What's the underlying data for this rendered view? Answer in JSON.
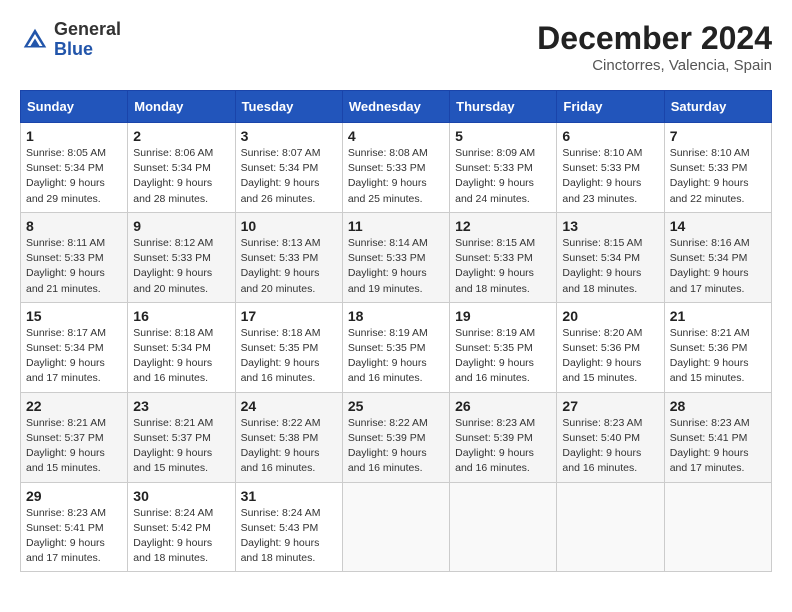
{
  "header": {
    "logo_general": "General",
    "logo_blue": "Blue",
    "month_title": "December 2024",
    "location": "Cinctorres, Valencia, Spain"
  },
  "weekdays": [
    "Sunday",
    "Monday",
    "Tuesday",
    "Wednesday",
    "Thursday",
    "Friday",
    "Saturday"
  ],
  "weeks": [
    [
      {
        "day": "1",
        "sunrise": "8:05 AM",
        "sunset": "5:34 PM",
        "daylight": "9 hours and 29 minutes."
      },
      {
        "day": "2",
        "sunrise": "8:06 AM",
        "sunset": "5:34 PM",
        "daylight": "9 hours and 28 minutes."
      },
      {
        "day": "3",
        "sunrise": "8:07 AM",
        "sunset": "5:34 PM",
        "daylight": "9 hours and 26 minutes."
      },
      {
        "day": "4",
        "sunrise": "8:08 AM",
        "sunset": "5:33 PM",
        "daylight": "9 hours and 25 minutes."
      },
      {
        "day": "5",
        "sunrise": "8:09 AM",
        "sunset": "5:33 PM",
        "daylight": "9 hours and 24 minutes."
      },
      {
        "day": "6",
        "sunrise": "8:10 AM",
        "sunset": "5:33 PM",
        "daylight": "9 hours and 23 minutes."
      },
      {
        "day": "7",
        "sunrise": "8:10 AM",
        "sunset": "5:33 PM",
        "daylight": "9 hours and 22 minutes."
      }
    ],
    [
      {
        "day": "8",
        "sunrise": "8:11 AM",
        "sunset": "5:33 PM",
        "daylight": "9 hours and 21 minutes."
      },
      {
        "day": "9",
        "sunrise": "8:12 AM",
        "sunset": "5:33 PM",
        "daylight": "9 hours and 20 minutes."
      },
      {
        "day": "10",
        "sunrise": "8:13 AM",
        "sunset": "5:33 PM",
        "daylight": "9 hours and 20 minutes."
      },
      {
        "day": "11",
        "sunrise": "8:14 AM",
        "sunset": "5:33 PM",
        "daylight": "9 hours and 19 minutes."
      },
      {
        "day": "12",
        "sunrise": "8:15 AM",
        "sunset": "5:33 PM",
        "daylight": "9 hours and 18 minutes."
      },
      {
        "day": "13",
        "sunrise": "8:15 AM",
        "sunset": "5:34 PM",
        "daylight": "9 hours and 18 minutes."
      },
      {
        "day": "14",
        "sunrise": "8:16 AM",
        "sunset": "5:34 PM",
        "daylight": "9 hours and 17 minutes."
      }
    ],
    [
      {
        "day": "15",
        "sunrise": "8:17 AM",
        "sunset": "5:34 PM",
        "daylight": "9 hours and 17 minutes."
      },
      {
        "day": "16",
        "sunrise": "8:18 AM",
        "sunset": "5:34 PM",
        "daylight": "9 hours and 16 minutes."
      },
      {
        "day": "17",
        "sunrise": "8:18 AM",
        "sunset": "5:35 PM",
        "daylight": "9 hours and 16 minutes."
      },
      {
        "day": "18",
        "sunrise": "8:19 AM",
        "sunset": "5:35 PM",
        "daylight": "9 hours and 16 minutes."
      },
      {
        "day": "19",
        "sunrise": "8:19 AM",
        "sunset": "5:35 PM",
        "daylight": "9 hours and 16 minutes."
      },
      {
        "day": "20",
        "sunrise": "8:20 AM",
        "sunset": "5:36 PM",
        "daylight": "9 hours and 15 minutes."
      },
      {
        "day": "21",
        "sunrise": "8:21 AM",
        "sunset": "5:36 PM",
        "daylight": "9 hours and 15 minutes."
      }
    ],
    [
      {
        "day": "22",
        "sunrise": "8:21 AM",
        "sunset": "5:37 PM",
        "daylight": "9 hours and 15 minutes."
      },
      {
        "day": "23",
        "sunrise": "8:21 AM",
        "sunset": "5:37 PM",
        "daylight": "9 hours and 15 minutes."
      },
      {
        "day": "24",
        "sunrise": "8:22 AM",
        "sunset": "5:38 PM",
        "daylight": "9 hours and 16 minutes."
      },
      {
        "day": "25",
        "sunrise": "8:22 AM",
        "sunset": "5:39 PM",
        "daylight": "9 hours and 16 minutes."
      },
      {
        "day": "26",
        "sunrise": "8:23 AM",
        "sunset": "5:39 PM",
        "daylight": "9 hours and 16 minutes."
      },
      {
        "day": "27",
        "sunrise": "8:23 AM",
        "sunset": "5:40 PM",
        "daylight": "9 hours and 16 minutes."
      },
      {
        "day": "28",
        "sunrise": "8:23 AM",
        "sunset": "5:41 PM",
        "daylight": "9 hours and 17 minutes."
      }
    ],
    [
      {
        "day": "29",
        "sunrise": "8:23 AM",
        "sunset": "5:41 PM",
        "daylight": "9 hours and 17 minutes."
      },
      {
        "day": "30",
        "sunrise": "8:24 AM",
        "sunset": "5:42 PM",
        "daylight": "9 hours and 18 minutes."
      },
      {
        "day": "31",
        "sunrise": "8:24 AM",
        "sunset": "5:43 PM",
        "daylight": "9 hours and 18 minutes."
      },
      null,
      null,
      null,
      null
    ]
  ],
  "labels": {
    "sunrise": "Sunrise:",
    "sunset": "Sunset:",
    "daylight": "Daylight:"
  }
}
